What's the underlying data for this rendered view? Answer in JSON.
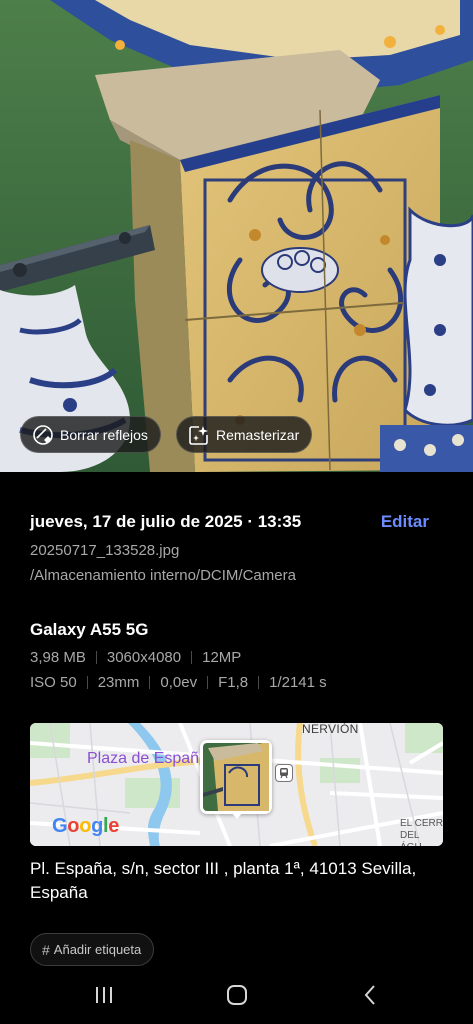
{
  "photo_actions": {
    "erase_reflections": {
      "label": "Borrar reflejos",
      "icon": "erase-reflection-icon"
    },
    "remaster": {
      "label": "Remasterizar",
      "icon": "sparkle-edit-icon"
    }
  },
  "details": {
    "datetime": "jueves, 17 de julio de 2025 · 13:35",
    "edit_label": "Editar",
    "filename": "20250717_133528.jpg",
    "path": "/Almacenamiento interno/DCIM/Camera"
  },
  "camera": {
    "device": "Galaxy A55 5G",
    "file_specs": [
      "3,98 MB",
      "3060x4080",
      "12MP"
    ],
    "exposure_specs": [
      "ISO 50",
      "23mm",
      "0,0ev",
      "F1,8",
      "1/2141 s"
    ]
  },
  "map": {
    "place_label": "Plaza de Españ",
    "district_label": "NERVIÓN",
    "corner_label_line1": "EL CERR",
    "corner_label_line2": "DEL ÁGU",
    "google_logo": [
      "G",
      "o",
      "o",
      "g",
      "l",
      "e"
    ]
  },
  "location": {
    "address": "Pl. España, s/n, sector III , planta 1ª, 41013 Sevilla, España"
  },
  "tags": {
    "add_tag_label": "Añadir etiqueta",
    "hash_symbol": "#"
  },
  "colors": {
    "accent": "#6d8bff",
    "secondary_text": "#a8a8a8",
    "map_place": "#8a4fd0"
  }
}
